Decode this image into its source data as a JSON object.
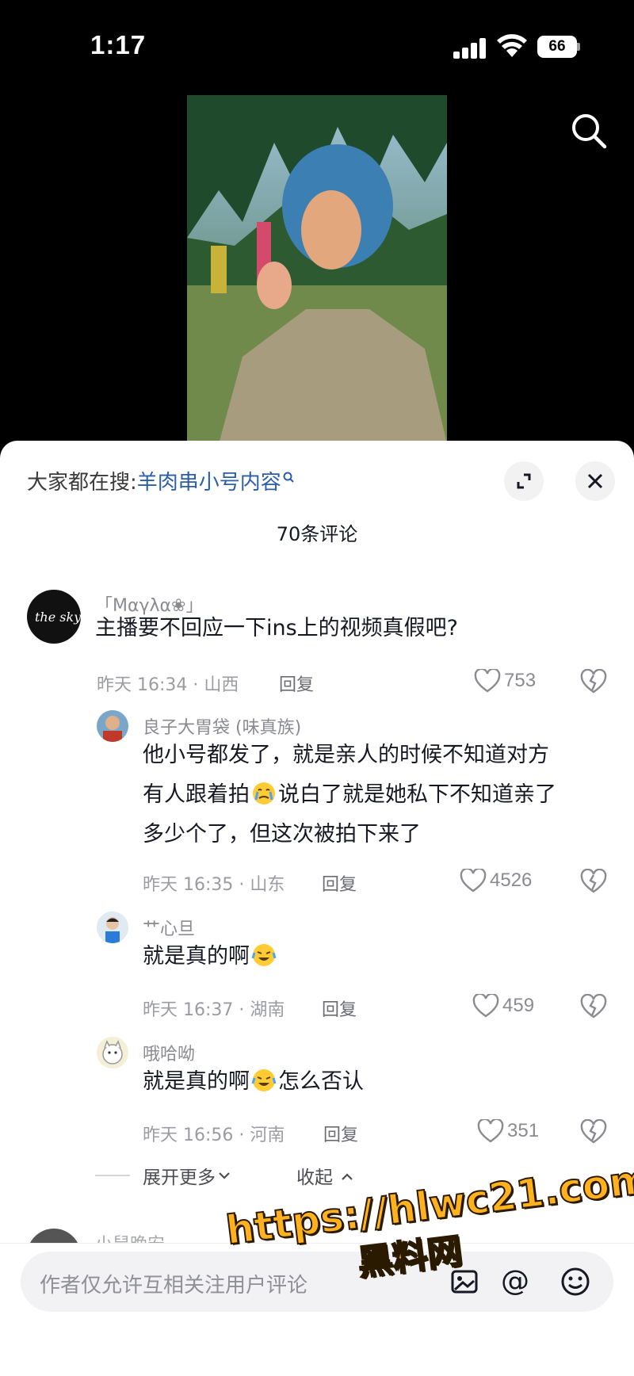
{
  "status_bar": {
    "time": "1:17",
    "battery": "66"
  },
  "header": {
    "search_icon": "search-icon"
  },
  "sheet": {
    "hot_label": "大家都在搜:",
    "hot_keyword": "羊肉串小号内容",
    "comment_count": "70条评论",
    "expand_icon": "expand-icon",
    "close_icon": "close-icon"
  },
  "comments": [
    {
      "user": "「Μαγλα❀」",
      "text": "主播要不回应一下ins上的视频真假吧?",
      "meta": "昨天 16:34 · 山西",
      "reply": "回复",
      "likes": "753"
    }
  ],
  "replies": [
    {
      "user": "良子大胃袋 (味真族)",
      "text_lines": [
        "他小号都发了，就是亲人的时候不知道对方",
        "有人跟着拍",
        "说白了就是她私下不知道亲了",
        "多少个了，但这次被拍下来了"
      ],
      "meta": "昨天 16:35 · 山东",
      "reply": "回复",
      "likes": "4526"
    },
    {
      "user": "艹心旦",
      "text": "就是真的啊",
      "meta": "昨天 16:37 · 湖南",
      "reply": "回复",
      "likes": "459"
    },
    {
      "user": "哦哈呦",
      "text": "就是真的啊",
      "text_after": "怎么否认",
      "meta": "昨天 16:56 · 河南",
      "reply": "回复",
      "likes": "351"
    }
  ],
  "thread_controls": {
    "expand_more": "展开更多",
    "collapse": "收起"
  },
  "next_comment_user": "小鼠晚安",
  "input": {
    "placeholder": "作者仅允许互相关注用户评论",
    "at": "@"
  },
  "watermark": {
    "line1": "https://hlwc21.com",
    "line2": "黑料网"
  }
}
